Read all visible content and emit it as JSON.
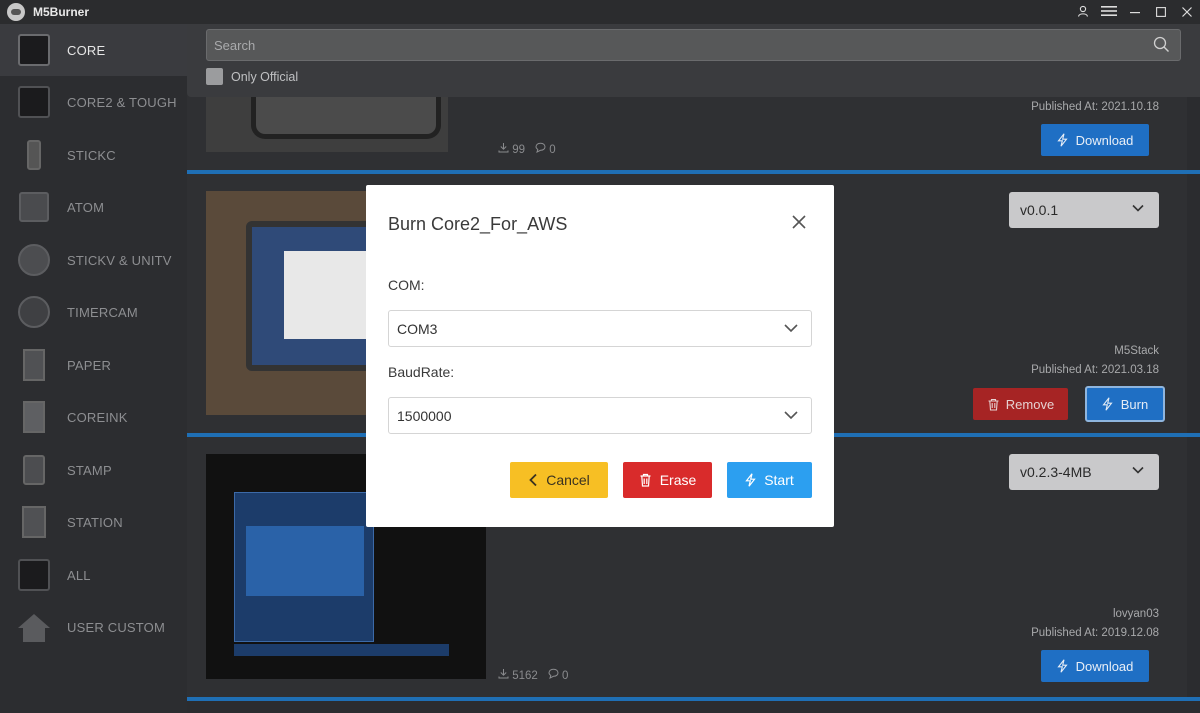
{
  "window": {
    "title": "M5Burner"
  },
  "sidebar": {
    "items": [
      {
        "label": "CORE",
        "active": true
      },
      {
        "label": "CORE2 & TOUGH"
      },
      {
        "label": "STICKC"
      },
      {
        "label": "ATOM"
      },
      {
        "label": "STICKV & UNITV"
      },
      {
        "label": "TIMERCAM"
      },
      {
        "label": "PAPER"
      },
      {
        "label": "COREINK"
      },
      {
        "label": "STAMP"
      },
      {
        "label": "STATION"
      },
      {
        "label": "ALL"
      },
      {
        "label": "USER CUSTOM"
      }
    ]
  },
  "search": {
    "placeholder": "Search",
    "only_official_label": "Only Official"
  },
  "cards": [
    {
      "published": "Published At: 2021.10.18",
      "downloads": "99",
      "comments": "0",
      "button": "Download"
    },
    {
      "version": "v0.0.1",
      "author": "M5Stack",
      "published": "Published At: 2021.03.18",
      "remove": "Remove",
      "burn": "Burn"
    },
    {
      "version": "v0.2.3-4MB",
      "author": "lovyan03",
      "published": "Published At: 2019.12.08",
      "downloads": "5162",
      "comments": "0",
      "button": "Download"
    }
  ],
  "modal": {
    "title": "Burn Core2_For_AWS",
    "com_label": "COM:",
    "com_value": "COM3",
    "baud_label": "BaudRate:",
    "baud_value": "1500000",
    "cancel": "Cancel",
    "erase": "Erase",
    "start": "Start"
  },
  "colors": {
    "accent": "#1f6fc4",
    "danger": "#d92b2b",
    "warning": "#f7bf24",
    "start": "#2c9ff0"
  }
}
